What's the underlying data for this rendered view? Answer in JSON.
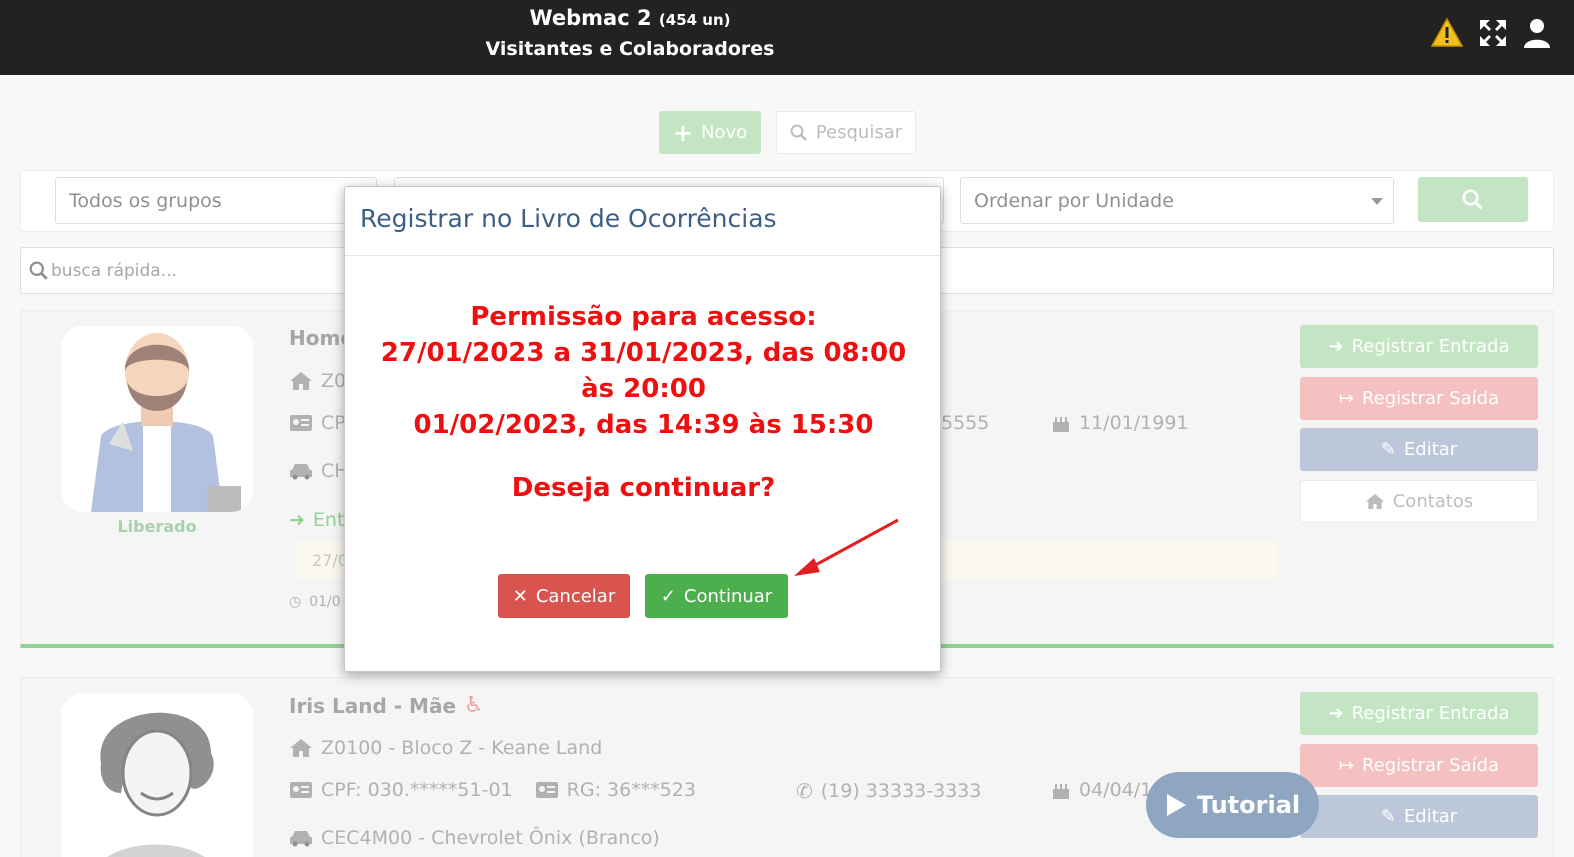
{
  "header": {
    "title": "Webmac 2",
    "count": "(454 un)",
    "subtitle": "Visitantes e Colaboradores",
    "icons": [
      "warning-icon",
      "fullscreen-icon",
      "user-icon"
    ]
  },
  "toolbar": {
    "new_label": "Novo",
    "search_label": "Pesquisar"
  },
  "filters": {
    "groups_value": "Todos os grupos",
    "order_value": "Ordenar por Unidade"
  },
  "quick_search": {
    "placeholder": "busca rápida..."
  },
  "cards": [
    {
      "name": "Home",
      "unit": "Z0",
      "cpf": "CP",
      "phone": "5555",
      "birth": "11/01/1991",
      "vehicle": "CH",
      "entry": "Ent",
      "notice": "27/0",
      "time": "01/0",
      "status": "Liberado",
      "actions": [
        "Registrar Entrada",
        "Registrar Saída",
        "Editar",
        "Contatos"
      ]
    },
    {
      "name": "Iris Land - Mãe",
      "unit": "Z0100 - Bloco Z - Keane Land",
      "cpf": "CPF: 030.*****51-01",
      "rg": "RG: 36***523",
      "phone": "(19) 33333-3333",
      "birth": "04/04/1",
      "vehicle": "CEC4M00 - Chevrolet Ônix (Branco)",
      "actions": [
        "Registrar Entrada",
        "Registrar Saída",
        "Editar"
      ]
    }
  ],
  "modal": {
    "title": "Registrar no Livro de Ocorrências",
    "line1": "Permissão para acesso:",
    "line2": "27/01/2023 a 31/01/2023, das 08:00 às 20:00",
    "line3": "01/02/2023, das 14:39 às 15:30",
    "question": "Deseja continuar?",
    "cancel_label": "Cancelar",
    "continue_label": "Continuar"
  },
  "tutorial_label": "Tutorial",
  "colors": {
    "topbar": "#222222",
    "green": "#5cb85c",
    "red": "#d9534f",
    "modal_title": "#3c5f88",
    "alert_text": "#ee1010"
  }
}
